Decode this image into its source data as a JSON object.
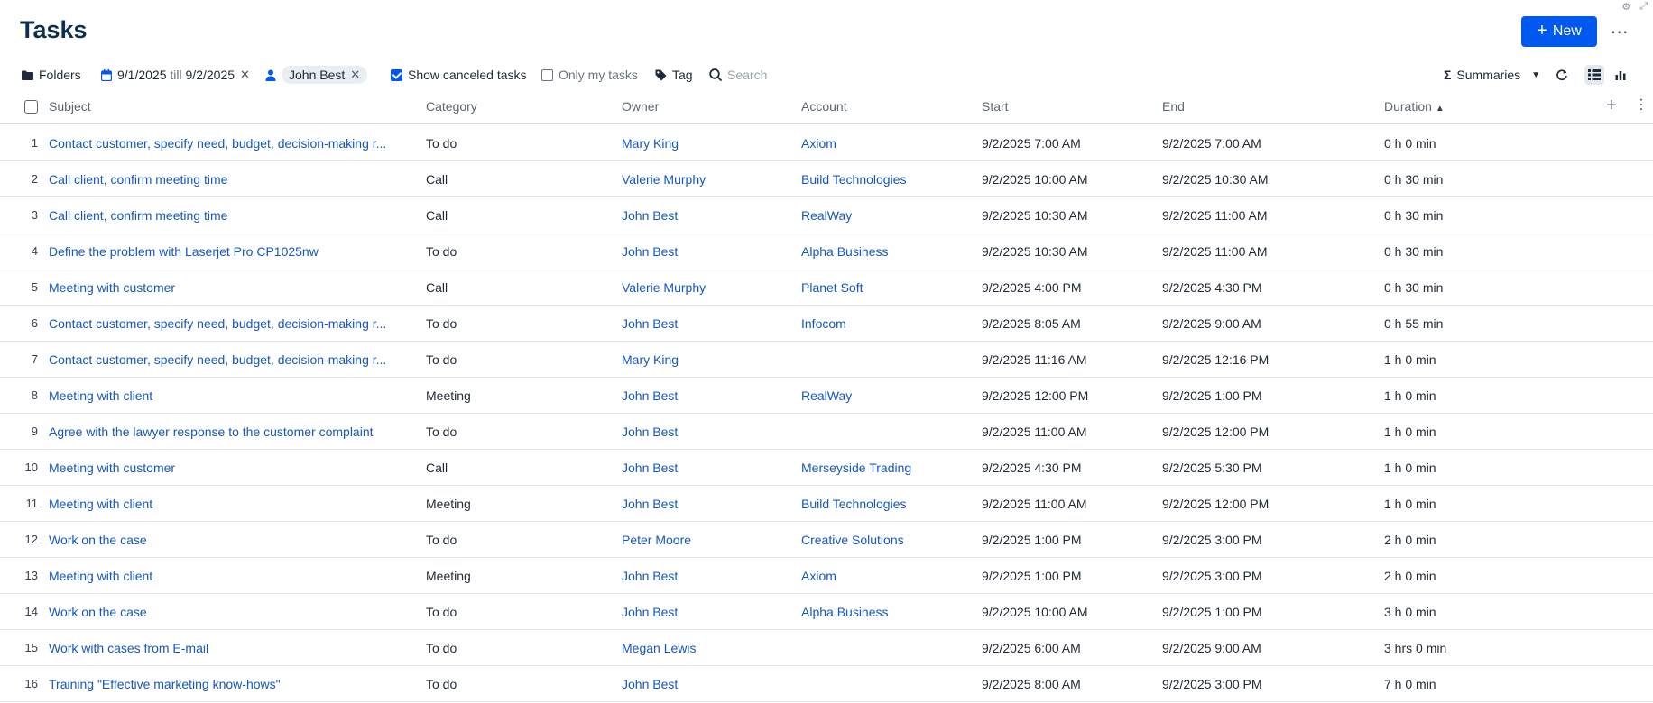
{
  "page": {
    "title": "Tasks"
  },
  "header": {
    "new_label": "New",
    "more_label": "⋯"
  },
  "toolbar": {
    "folders_label": "Folders",
    "date_from": "9/1/2025",
    "date_till_word": "till",
    "date_to": "9/2/2025",
    "owner_filter": "John Best",
    "show_canceled_label": "Show canceled tasks",
    "only_my_label": "Only my tasks",
    "tag_label": "Tag",
    "search_placeholder": "Search",
    "summaries_label": "Summaries"
  },
  "columns": {
    "subject": "Subject",
    "category": "Category",
    "owner": "Owner",
    "account": "Account",
    "start": "Start",
    "end": "End",
    "duration": "Duration"
  },
  "rows": [
    {
      "n": "1",
      "subject": "Contact customer, specify need, budget, decision-making r...",
      "category": "To do",
      "owner": "Mary King",
      "account": "Axiom",
      "start": "9/2/2025 7:00 AM",
      "end": "9/2/2025 7:00 AM",
      "duration": "0 h 0 min"
    },
    {
      "n": "2",
      "subject": "Call client, confirm meeting time",
      "category": "Call",
      "owner": "Valerie Murphy",
      "account": "Build Technologies",
      "start": "9/2/2025 10:00 AM",
      "end": "9/2/2025 10:30 AM",
      "duration": "0 h 30 min"
    },
    {
      "n": "3",
      "subject": "Call client, confirm meeting time",
      "category": "Call",
      "owner": "John Best",
      "account": "RealWay",
      "start": "9/2/2025 10:30 AM",
      "end": "9/2/2025 11:00 AM",
      "duration": "0 h 30 min"
    },
    {
      "n": "4",
      "subject": "Define the problem with Laserjet Pro CP1025nw",
      "category": "To do",
      "owner": "John Best",
      "account": "Alpha Business",
      "start": "9/2/2025 10:30 AM",
      "end": "9/2/2025 11:00 AM",
      "duration": "0 h 30 min"
    },
    {
      "n": "5",
      "subject": "Meeting with customer",
      "category": "Call",
      "owner": "Valerie Murphy",
      "account": "Planet Soft",
      "start": "9/2/2025 4:00 PM",
      "end": "9/2/2025 4:30 PM",
      "duration": "0 h 30 min"
    },
    {
      "n": "6",
      "subject": "Contact customer, specify need, budget, decision-making r...",
      "category": "To do",
      "owner": "John Best",
      "account": "Infocom",
      "start": "9/2/2025 8:05 AM",
      "end": "9/2/2025 9:00 AM",
      "duration": "0 h 55 min"
    },
    {
      "n": "7",
      "subject": "Contact customer, specify need, budget, decision-making r...",
      "category": "To do",
      "owner": "Mary King",
      "account": "",
      "start": "9/2/2025 11:16 AM",
      "end": "9/2/2025 12:16 PM",
      "duration": "1 h 0 min"
    },
    {
      "n": "8",
      "subject": "Meeting with client",
      "category": "Meeting",
      "owner": "John Best",
      "account": "RealWay",
      "start": "9/2/2025 12:00 PM",
      "end": "9/2/2025 1:00 PM",
      "duration": "1 h 0 min"
    },
    {
      "n": "9",
      "subject": "Agree with the lawyer response to the customer complaint",
      "category": "To do",
      "owner": "John Best",
      "account": "",
      "start": "9/2/2025 11:00 AM",
      "end": "9/2/2025 12:00 PM",
      "duration": "1 h 0 min"
    },
    {
      "n": "10",
      "subject": "Meeting with customer",
      "category": "Call",
      "owner": "John Best",
      "account": "Merseyside Trading",
      "start": "9/2/2025 4:30 PM",
      "end": "9/2/2025 5:30 PM",
      "duration": "1 h 0 min"
    },
    {
      "n": "11",
      "subject": "Meeting with client",
      "category": "Meeting",
      "owner": "John Best",
      "account": "Build Technologies",
      "start": "9/2/2025 11:00 AM",
      "end": "9/2/2025 12:00 PM",
      "duration": "1 h 0 min"
    },
    {
      "n": "12",
      "subject": "Work on the case",
      "category": "To do",
      "owner": "Peter Moore",
      "account": "Creative Solutions",
      "start": "9/2/2025 1:00 PM",
      "end": "9/2/2025 3:00 PM",
      "duration": "2 h 0 min"
    },
    {
      "n": "13",
      "subject": "Meeting with client",
      "category": "Meeting",
      "owner": "John Best",
      "account": "Axiom",
      "start": "9/2/2025 1:00 PM",
      "end": "9/2/2025 3:00 PM",
      "duration": "2 h 0 min"
    },
    {
      "n": "14",
      "subject": "Work on the case",
      "category": "To do",
      "owner": "John Best",
      "account": "Alpha Business",
      "start": "9/2/2025 10:00 AM",
      "end": "9/2/2025 1:00 PM",
      "duration": "3 h 0 min"
    },
    {
      "n": "15",
      "subject": "Work with cases from E-mail",
      "category": "To do",
      "owner": "Megan Lewis",
      "account": "",
      "start": "9/2/2025 6:00 AM",
      "end": "9/2/2025 9:00 AM",
      "duration": "3 hrs 0 min"
    },
    {
      "n": "16",
      "subject": "Training \"Effective marketing know-hows\"",
      "category": "To do",
      "owner": "John Best",
      "account": "",
      "start": "9/2/2025 8:00 AM",
      "end": "9/2/2025 3:00 PM",
      "duration": "7 h 0 min"
    }
  ]
}
